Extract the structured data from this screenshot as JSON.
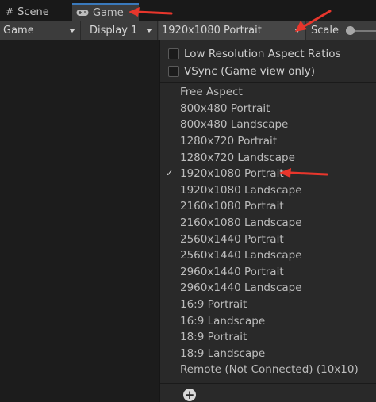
{
  "tabs": [
    {
      "label": "Scene",
      "icon": "hash-grid-icon"
    },
    {
      "label": "Game",
      "icon": "gamepad-icon"
    }
  ],
  "toolbar": {
    "display_mode": "Game",
    "display": "Display 1",
    "resolution": "1920x1080 Portrait",
    "scale_label": "Scale"
  },
  "menu": {
    "toggles": [
      {
        "label": "Low Resolution Aspect Ratios",
        "checked": false
      },
      {
        "label": "VSync (Game view only)",
        "checked": false
      }
    ],
    "items": [
      {
        "label": "Free Aspect"
      },
      {
        "label": "800x480 Portrait"
      },
      {
        "label": "800x480 Landscape"
      },
      {
        "label": "1280x720 Portrait"
      },
      {
        "label": "1280x720 Landscape"
      },
      {
        "label": "1920x1080 Portrait",
        "selected": true,
        "check": "✓"
      },
      {
        "label": "1920x1080 Landscape"
      },
      {
        "label": "2160x1080 Portrait"
      },
      {
        "label": "2160x1080 Landscape"
      },
      {
        "label": "2560x1440 Portrait"
      },
      {
        "label": "2560x1440 Landscape"
      },
      {
        "label": "2960x1440 Portrait"
      },
      {
        "label": "2960x1440 Landscape"
      },
      {
        "label": "16:9 Portrait"
      },
      {
        "label": "16:9 Landscape"
      },
      {
        "label": "18:9 Portrait"
      },
      {
        "label": "18:9 Landscape"
      },
      {
        "label": "Remote (Not Connected) (10x10)"
      }
    ],
    "add_icon": "plus-icon"
  },
  "colors": {
    "annotation_arrow": "#e8362c",
    "toolbar_bg": "#3c3c3c",
    "menu_bg": "#292929"
  }
}
